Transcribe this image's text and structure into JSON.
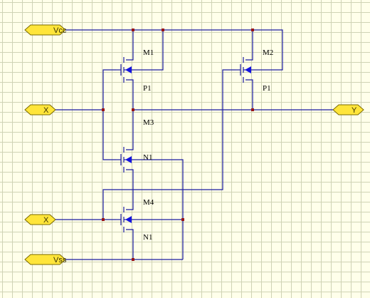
{
  "ports": {
    "vcc": "Vcc",
    "x_top": "X",
    "y_out": "Y",
    "x_bottom": "X",
    "vss": "Vss"
  },
  "transistors": [
    {
      "name": "M1",
      "model": "P1"
    },
    {
      "name": "M2",
      "model": "P1"
    },
    {
      "name": "M3",
      "model": "N1"
    },
    {
      "name": "M4",
      "model": "N1"
    }
  ],
  "colors": {
    "background": "#ffffea",
    "grid": "#cfd3b5",
    "wire": "#1c1ca0",
    "junction": "#9a1414",
    "port_fill": "#ffe53a",
    "arrow": "#1414e0"
  }
}
